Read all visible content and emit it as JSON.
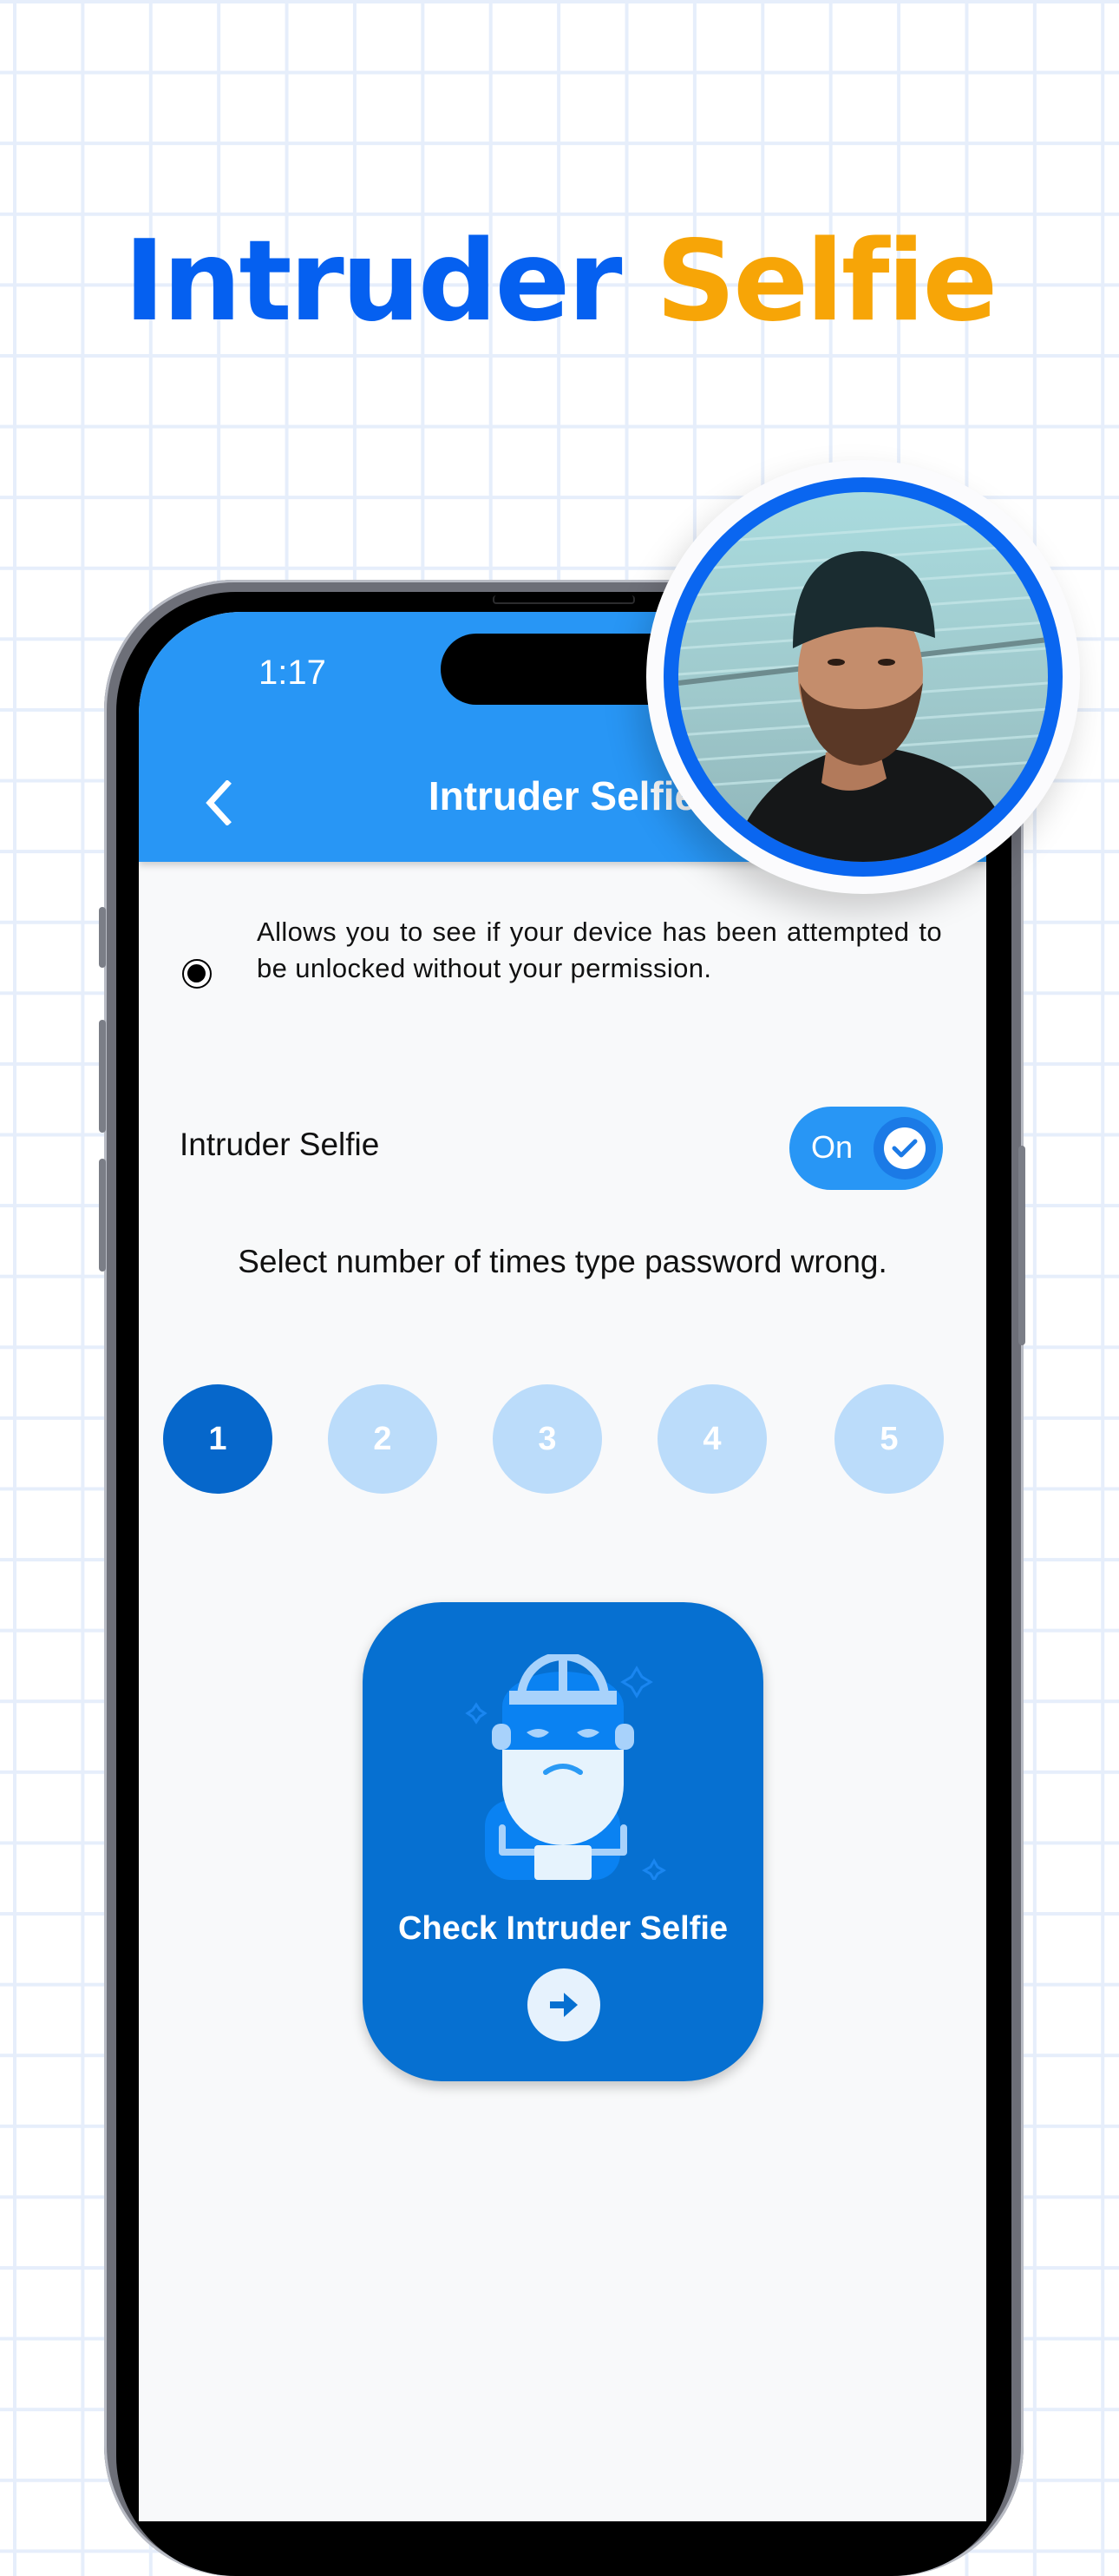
{
  "hero": {
    "title_part1": "Intruder",
    "title_part2": "Selfie",
    "colors": {
      "part1": "#0560f0",
      "part2": "#f7a507"
    }
  },
  "status_bar": {
    "time": "1:17"
  },
  "app_bar": {
    "back_icon": "chevron-left-icon",
    "title": "Intruder Selfie",
    "color": "#2896f5"
  },
  "description": {
    "icon": "radio-selected-icon",
    "text": "Allows you to see if your device has been attempted to be unlocked without your permission."
  },
  "intruder_toggle": {
    "label": "Intruder Selfie",
    "state_label": "On",
    "enabled": true,
    "icon": "check-circle-icon"
  },
  "attempts": {
    "prompt": "Select number of times type password wrong.",
    "options": [
      "1",
      "2",
      "3",
      "4",
      "5"
    ],
    "selected": "1",
    "colors": {
      "active": "#0667cb",
      "inactive": "#bbdcfa"
    }
  },
  "check_card": {
    "illustration": "intruder-thief-icon",
    "label": "Check Intruder Selfie",
    "arrow_icon": "arrow-right-icon",
    "color": "#0670d1"
  },
  "photo_badge": {
    "subject": "man-in-cap-photo",
    "ring_color": "#0a66f0"
  }
}
